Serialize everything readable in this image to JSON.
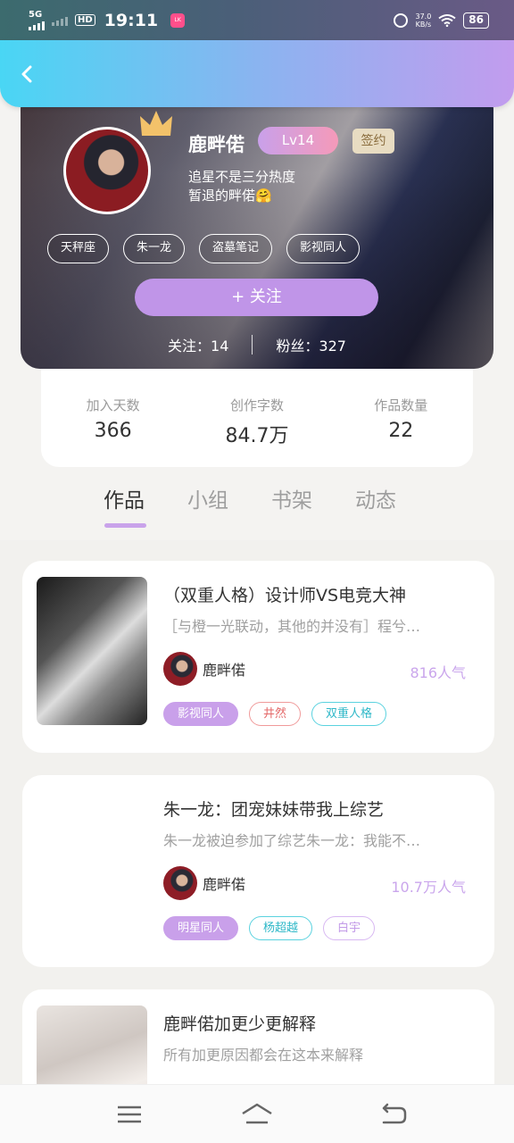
{
  "status_bar": {
    "network": "5G",
    "time": "19:11",
    "speed_value": "37.0",
    "speed_unit": "KB/s",
    "battery": "86"
  },
  "profile": {
    "username": "鹿畔偌",
    "level": "Lv14",
    "signed_label": "签约",
    "bio_line1": "追星不是三分热度",
    "bio_line2": "暂退的畔偌🤗",
    "tags": [
      "天秤座",
      "朱一龙",
      "盗墓笔记",
      "影视同人"
    ],
    "follow_button": "+ 关注",
    "following_label": "关注：14",
    "followers_label": "粉丝：327"
  },
  "stats": [
    {
      "label": "加入天数",
      "value": "366"
    },
    {
      "label": "创作字数",
      "value": "84.7万"
    },
    {
      "label": "作品数量",
      "value": "22"
    }
  ],
  "tabs": [
    "作品",
    "小组",
    "书架",
    "动态"
  ],
  "works": [
    {
      "title": "（双重人格）设计师VS电竞大神",
      "desc": "［与橙一光联动，其他的并没有］程兮…",
      "author": "鹿畔偌",
      "popularity": "816人气",
      "tags": [
        "影视同人",
        "井然",
        "双重人格"
      ]
    },
    {
      "title": "朱一龙：团宠妹妹带我上综艺",
      "desc": "朱一龙被迫参加了综艺朱一龙：我能不…",
      "author": "鹿畔偌",
      "popularity": "10.7万人气",
      "tags": [
        "明星同人",
        "杨超越",
        "白宇"
      ]
    },
    {
      "title": "鹿畔偌加更少更解释",
      "desc": "所有加更原因都会在这本来解释"
    }
  ]
}
